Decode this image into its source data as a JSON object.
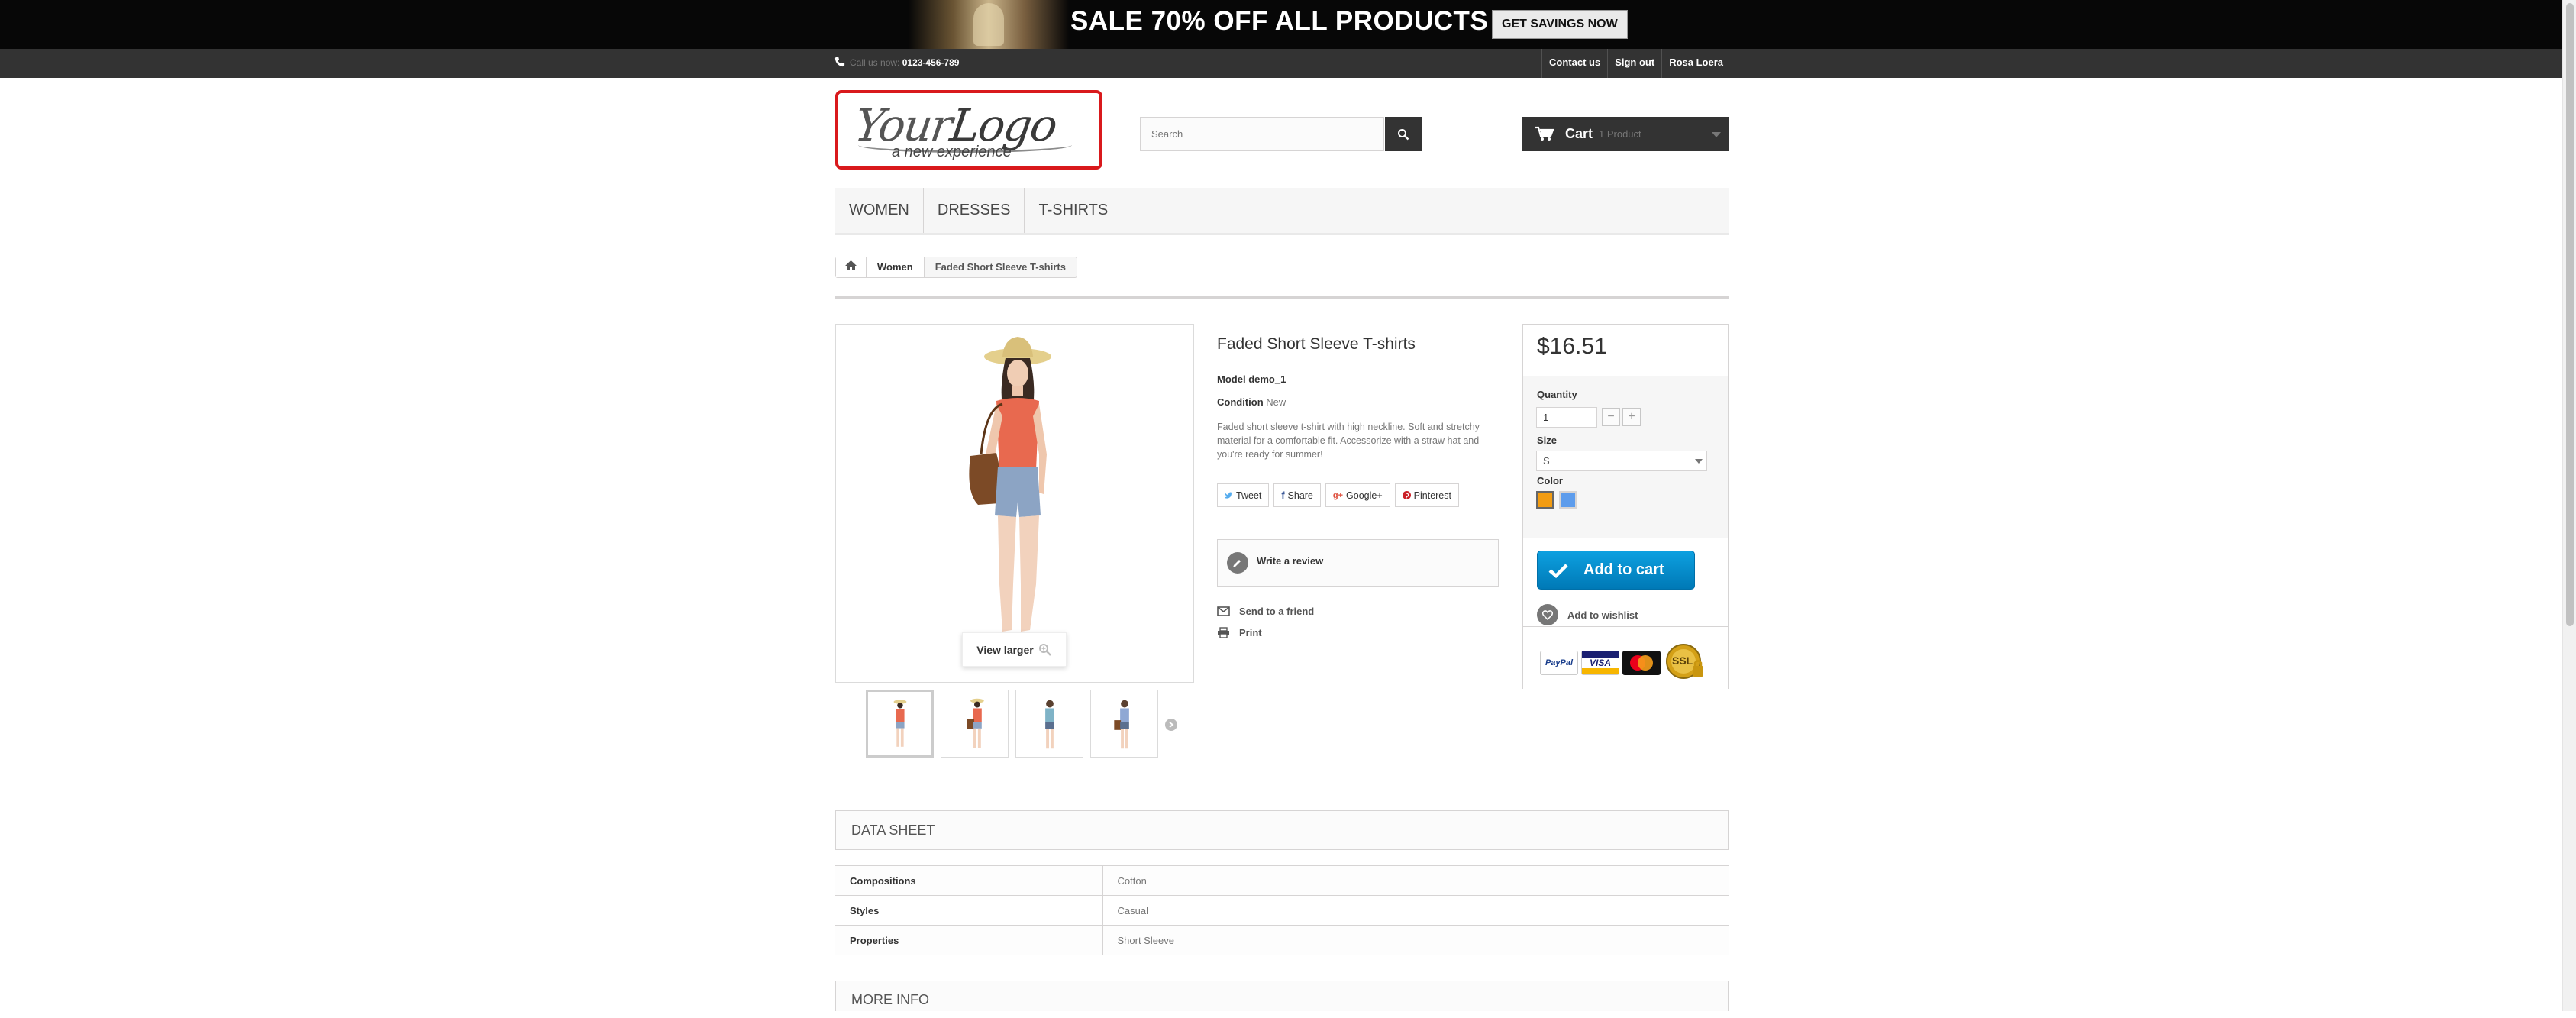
{
  "banner": {
    "headline": "SALE 70% OFF ALL PRODUCTS",
    "cta": "GET SAVINGS NOW"
  },
  "topbar": {
    "call_label": "Call us now:",
    "phone": "0123-456-789",
    "links": {
      "contact": "Contact us",
      "signout": "Sign out",
      "user": "Rosa Loera"
    }
  },
  "logo": {
    "line1a": "Your",
    "line1b": "Logo",
    "tagline": "a new experience"
  },
  "search": {
    "placeholder": "Search"
  },
  "cart": {
    "label": "Cart",
    "count": "1 Product"
  },
  "menu": {
    "women": "WOMEN",
    "dresses": "DRESSES",
    "tshirts": "T-SHIRTS"
  },
  "breadcrumb": {
    "level1": "Women",
    "current": "Faded Short Sleeve T-shirts"
  },
  "product": {
    "title": "Faded Short Sleeve T-shirts",
    "model_label": "Model",
    "model": "demo_1",
    "condition_label": "Condition",
    "condition": "New",
    "description": "Faded short sleeve t-shirt with high neckline. Soft and stretchy material for a comfortable fit. Accessorize with a straw hat and you're ready for summer!",
    "view_larger": "View larger"
  },
  "social": {
    "tweet": "Tweet",
    "share": "Share",
    "google": "Google+",
    "pinterest": "Pinterest"
  },
  "actions": {
    "review": "Write a review",
    "send_friend": "Send to a friend",
    "print": "Print"
  },
  "buy": {
    "price": "$16.51",
    "quantity_label": "Quantity",
    "quantity": "1",
    "size_label": "Size",
    "size": "S",
    "color_label": "Color",
    "colors": [
      "#f39c11",
      "#5d9cec"
    ],
    "add_to_cart": "Add to cart",
    "wishlist": "Add to wishlist",
    "payment": {
      "paypal": "PayPal",
      "visa": "VISA",
      "mastercard": "MasterCard",
      "ssl": "SSL"
    }
  },
  "datasheet": {
    "title": "DATA SHEET",
    "rows": [
      {
        "key": "Compositions",
        "value": "Cotton"
      },
      {
        "key": "Styles",
        "value": "Casual"
      },
      {
        "key": "Properties",
        "value": "Short Sleeve"
      }
    ]
  },
  "more_info": {
    "title": "MORE INFO"
  },
  "colors": {
    "accent_red": "#d9191c",
    "dark_bar": "#333333",
    "button_blue": "#0079b6"
  }
}
